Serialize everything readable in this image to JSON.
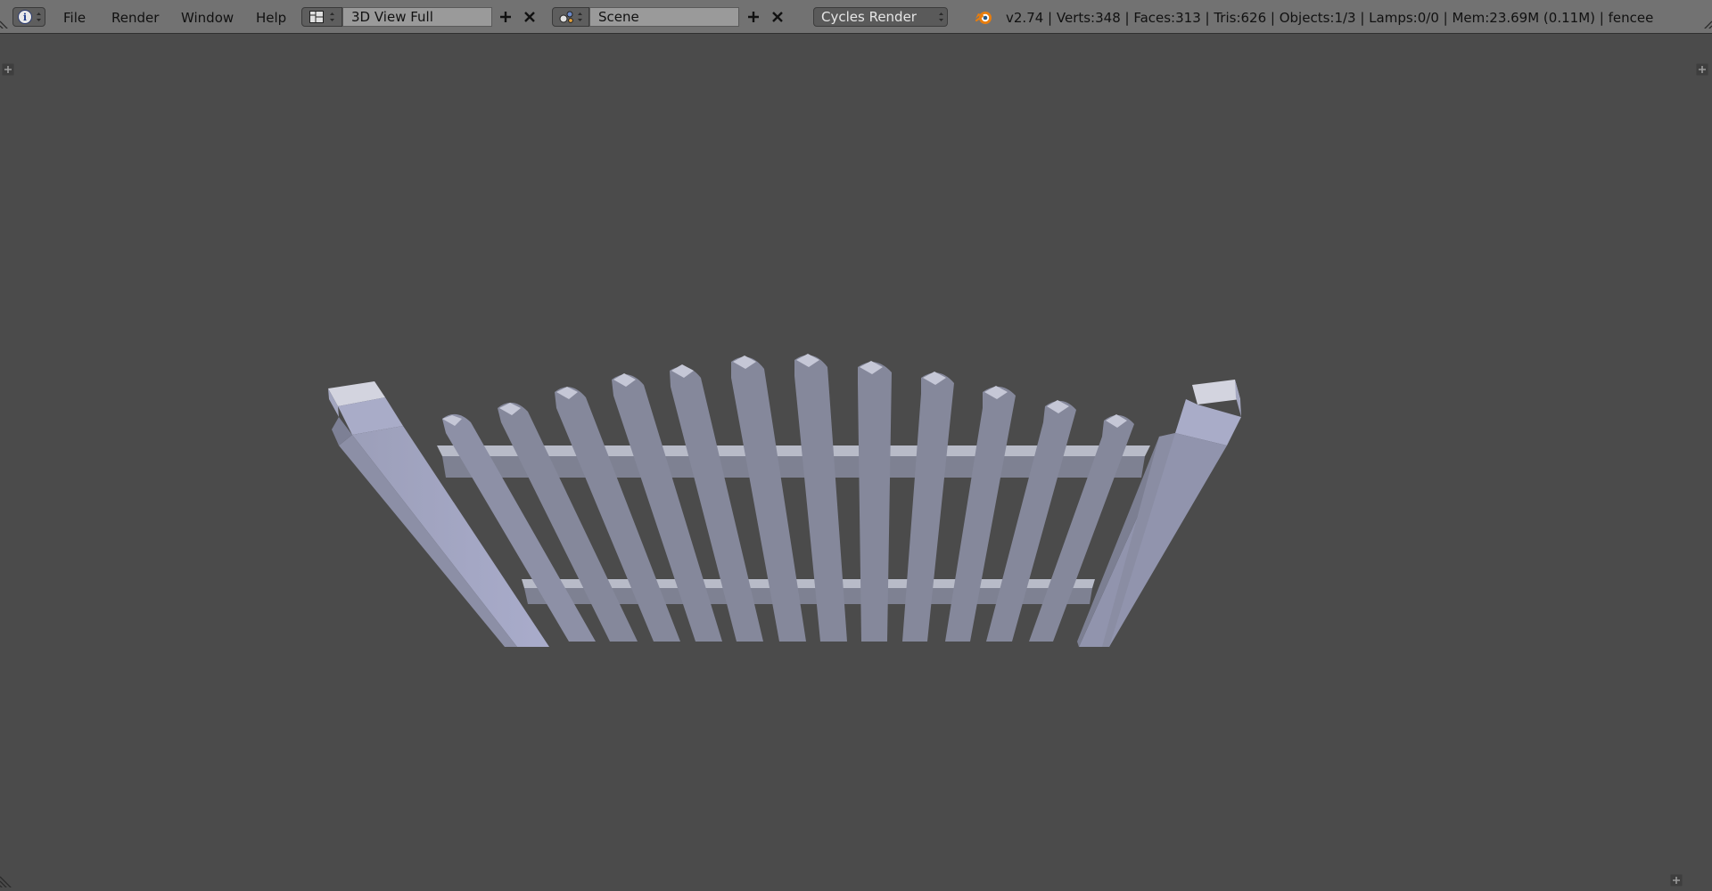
{
  "header": {
    "editor_type_icon": "info-icon",
    "menu": [
      "File",
      "Render",
      "Window",
      "Help"
    ],
    "screen_layout": {
      "icon": "screen-layout-icon",
      "value": "3D View Full"
    },
    "scene": {
      "icon": "scene-icon",
      "value": "Scene"
    },
    "render_engine": "Cycles Render",
    "stats": "v2.74 | Verts:348 | Faces:313 | Tris:626 | Objects:1/3 | Lamps:0/0 | Mem:23.69M (0.11M) | fencee"
  },
  "viewport": {
    "object": "picket-fence",
    "background_color": "#4b4b4b",
    "fence_color": "#8a8d9e"
  }
}
